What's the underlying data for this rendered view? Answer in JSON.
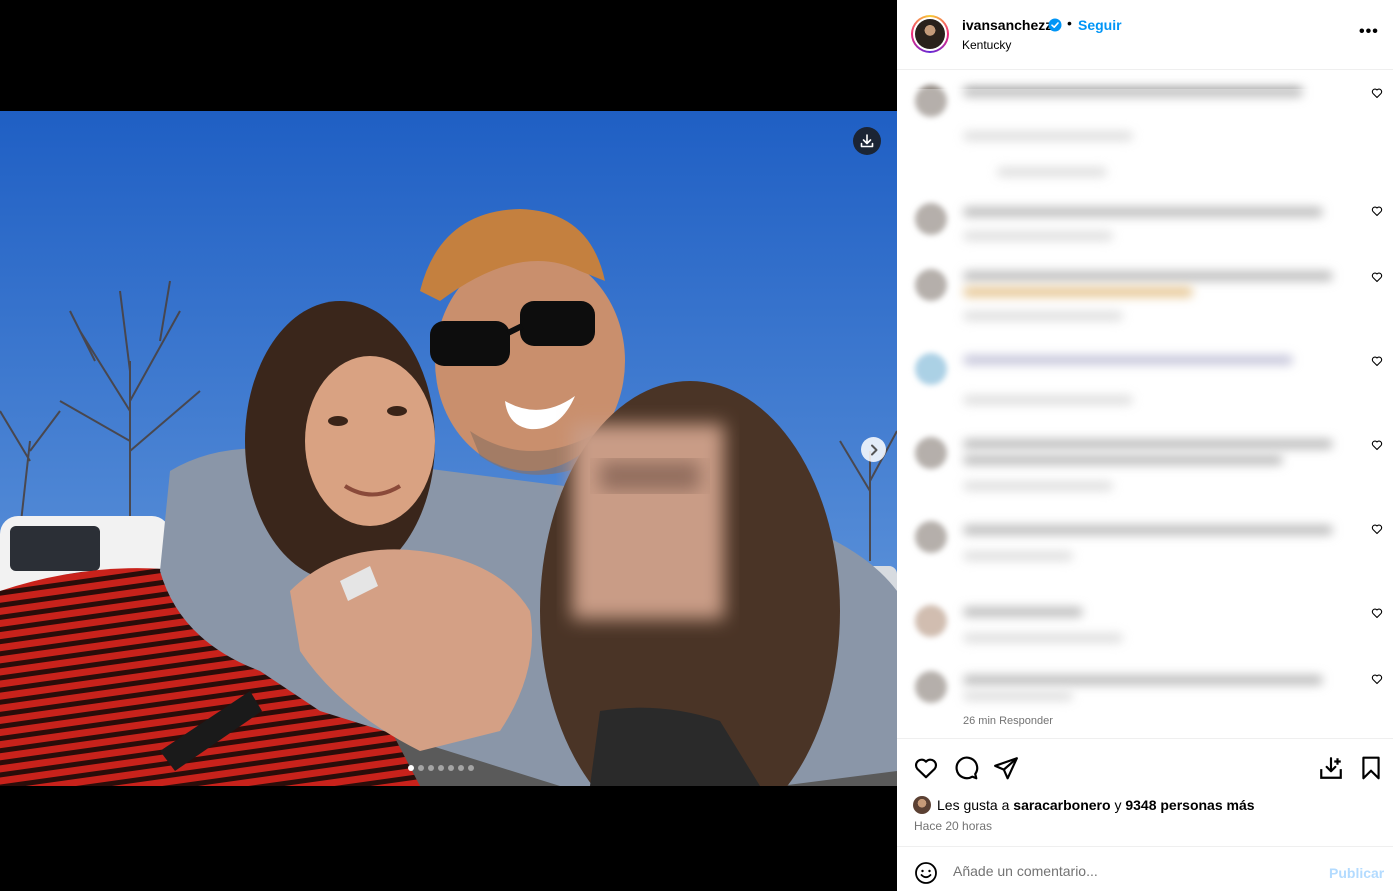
{
  "post": {
    "username": "ivansanchezz",
    "follow_label": "Seguir",
    "separator": "•",
    "location": "Kentucky",
    "more_label": "•••"
  },
  "carousel": {
    "slide_count": 7,
    "active_index": 0
  },
  "comments": {
    "blurred_count": 9,
    "partial_footer": "26 min   Responder"
  },
  "likes": {
    "prefix": "Les gusta a ",
    "user": "saracarbonero",
    "middle": " y ",
    "count_text": "9348 personas más",
    "time": "Hace 20 horas"
  },
  "composer": {
    "placeholder": "Añade un comentario...",
    "publish_label": "Publicar"
  },
  "colors": {
    "accent": "#0095f6",
    "publish_disabled": "#b3dbff",
    "sky": "#2f6fcf"
  },
  "icons": [
    "download-icon",
    "chevron-right-icon",
    "verified-icon",
    "more-icon",
    "heart-icon",
    "comment-icon",
    "share-icon",
    "save-icon",
    "emoji-icon"
  ]
}
